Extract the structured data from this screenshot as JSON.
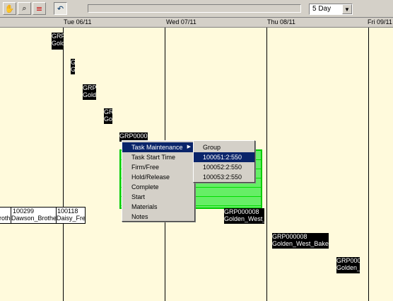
{
  "toolbar": {
    "icons": [
      "hand-icon",
      "zoom-icon",
      "gantt-icon",
      "undo-icon"
    ],
    "view_select": "5 Day"
  },
  "days": [
    "Tue 06/11",
    "Wed 07/11",
    "Thu 08/11",
    "Fri 09/11"
  ],
  "tasks": {
    "t1_line1": "GRP",
    "t1_line2": "Gold",
    "t2_line1": "G",
    "t2_line2": "G",
    "t3_line1": "GRP",
    "t3_line2": "Gold",
    "t4_line1": "GR",
    "t4_line2": "Go",
    "t5_line1": "GRP0000",
    "t6_line1": "GRP000008",
    "t6_line2": "Golden_West_",
    "t7_line1": "GRP000008",
    "t7_line2": "Golden_West_Bake",
    "t8_line1": "GRP000",
    "t8_line2": "Golden_",
    "w1_id": "100299",
    "w1_name": "Dawson_Brothe",
    "w0_name": "rothe",
    "w2_id": "100118",
    "w2_name": "Daisy_Fre"
  },
  "context_menu": {
    "items": [
      "Task Maintenance",
      "Task Start Time",
      "Firm/Free",
      "Hold/Release",
      "Complete",
      "Start",
      "Materials",
      "Notes"
    ]
  },
  "submenu": {
    "items": [
      "Group",
      "100051:2:550",
      "100052:2:550",
      "100053:2:550"
    ]
  },
  "colors": {
    "canvas": "#fffadc",
    "selection": "#0a246a",
    "green_block": "#66ee66"
  }
}
